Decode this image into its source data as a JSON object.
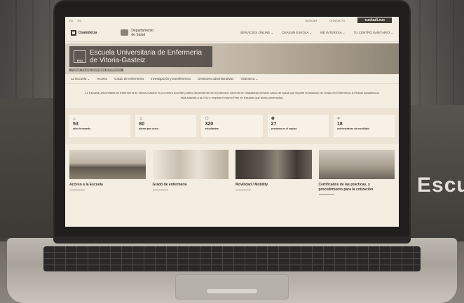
{
  "background_sign": "Escu",
  "site": {
    "languages": [
      "EU",
      "ES"
    ],
    "top_links": [
      "BUSCAR",
      "CONTACTO"
    ],
    "euskadi_label": "euskadi.eus",
    "osakidetza_label": "Osakidetza",
    "department_label": "Departamento de Salud",
    "main_nav": [
      "SERVICIOS ONLINE ⌄",
      "OSASUN ESKOLA ⌄",
      "ME INTERESA ⌄",
      "TU CENTRO SANITARIO ⌄"
    ],
    "hero_logo_text": "EHU",
    "hero_title": "Escuela Universitaria de Enfermería de Vitoria-Gasteiz",
    "breadcrumb": "Portada  /  Escuela Universitaria de Enfermería",
    "sub_nav": [
      "La Escuela ⌄",
      "Acceso",
      "Grado de enfermería",
      "Investigación y transferencia",
      "Gestiones administrativas",
      "Videoteca ⌄"
    ],
    "intro_text": "La Escuela Universitaria de Enfermería de Vitoria-Gasteiz es un centro docente público dependiente de la Dirección General de Osakidetza-Servicio vasco de salud que imparte la titulación de Grado en Enfermería. A efectos académicos está adscrito a la EHU y emplea el mismo Plan de Estudios que dicha universidad.",
    "stats": [
      {
        "icon": "graduation-cap-icon",
        "number": "53",
        "label": "años formando"
      },
      {
        "icon": "student-icon",
        "number": "80",
        "label": "plazas por curso"
      },
      {
        "icon": "students-group-icon",
        "number": "320",
        "label": "estudiantes"
      },
      {
        "icon": "team-icon",
        "number": "27",
        "label": "personas en el equipo"
      },
      {
        "icon": "plane-icon",
        "number": "18",
        "label": "universidades de movilidad"
      }
    ],
    "cards": [
      {
        "title": "Acceso a la Escuela"
      },
      {
        "title": "Grado de enfermería"
      },
      {
        "title": "Movilidad / Mobility"
      },
      {
        "title": "Certificados de las prácticas, y procedimiento para la cotización"
      }
    ]
  }
}
